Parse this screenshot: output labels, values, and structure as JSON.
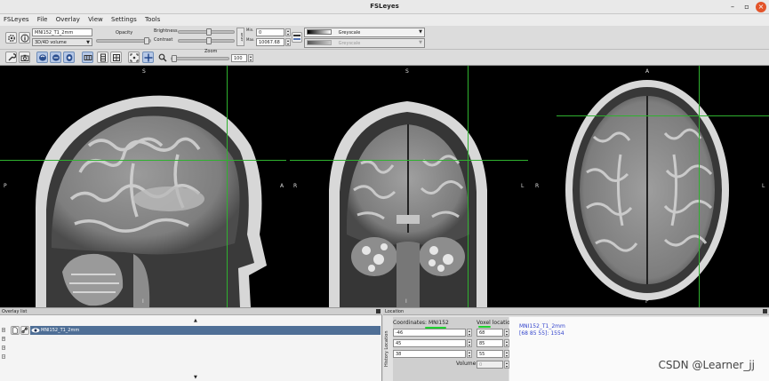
{
  "window": {
    "title": "FSLeyes"
  },
  "menu": [
    "FSLeyes",
    "File",
    "Overlay",
    "View",
    "Settings",
    "Tools"
  ],
  "overlay_toolbar": {
    "overlay_name": "MNI152_T1_2mm",
    "overlay_type": "3D/4D volume",
    "opacity_label": "Opacity",
    "brightness_label": "Brightness",
    "contrast_label": "Contrast",
    "min_label": "Min.",
    "max_label": "Max.",
    "min_value": "0",
    "max_value": "10067.68",
    "reset_label": "RESET",
    "colormap": "Greyscale",
    "neg_colormap": "Greyscale",
    "brightness_fraction": 0.55,
    "contrast_fraction": 0.55,
    "opacity_fraction": 0.98
  },
  "ortho_toolbar": {
    "zoom_label": "Zoom",
    "zoom_value": "100",
    "zoom_fraction": 0.0
  },
  "views": {
    "sagittal": {
      "top": "S",
      "bottom": "I",
      "left": "P",
      "right": "A"
    },
    "coronal": {
      "top": "S",
      "bottom": "I",
      "left": "R",
      "right": "L"
    },
    "axial": {
      "top": "A",
      "bottom": "P",
      "left": "R",
      "right": "L"
    }
  },
  "overlay_list": {
    "title": "Overlay list",
    "items": [
      {
        "name": "MNI152_T1_2mm",
        "selected": true
      }
    ]
  },
  "location_panel": {
    "title": "Location",
    "side_tabs": "History   Location",
    "coord_label": "Coordinates: MNI152",
    "voxel_label": "Voxel location",
    "world": [
      "-46",
      "45",
      "38"
    ],
    "voxel": [
      "68",
      "85",
      "55"
    ],
    "volume_label": "Volume",
    "volume_value": "0",
    "info_name": "MNI152_T1_2mm",
    "info_value": "[68 85 55]: 1554"
  },
  "watermark": "CSDN @Learner_jj",
  "colors": {
    "crosshair": "#2fb12f",
    "selection": "#4f6f96",
    "info_text": "#3344cc",
    "annotation_underline": "#1fd12f"
  }
}
